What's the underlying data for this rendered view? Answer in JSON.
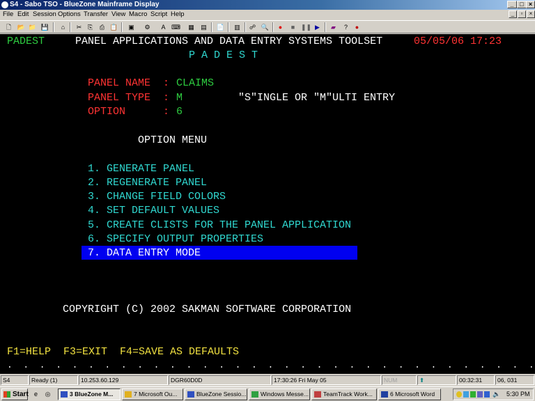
{
  "window": {
    "title": "S4 - Sabo TSO - BlueZone Mainframe Display"
  },
  "menu": [
    "File",
    "Edit",
    "Session",
    "Options",
    "Transfer",
    "View",
    "Macro",
    "Script",
    "Help"
  ],
  "terminal": {
    "app_id": "PADEST",
    "header_title": "PANEL APPLICATIONS AND DATA ENTRY SYSTEMS TOOLSET",
    "datetime": "05/05/06 17:23",
    "subtitle": "P A D E S T",
    "fields": [
      {
        "label": "PANEL NAME  :",
        "value": "CLAIMS",
        "hint": ""
      },
      {
        "label": "PANEL TYPE  :",
        "value": "M",
        "hint": "\"S\"INGLE OR \"M\"ULTI ENTRY"
      },
      {
        "label": "OPTION      :",
        "value": "6",
        "hint": ""
      }
    ],
    "menu_title": "OPTION MENU",
    "options": [
      "1. GENERATE PANEL",
      "2. REGENERATE PANEL",
      "3. CHANGE FIELD COLORS",
      "4. SET DEFAULT VALUES",
      "5. CREATE CLISTS FOR THE PANEL APPLICATION",
      "6. SPECIFY OUTPUT PROPERTIES",
      "7. DATA ENTRY MODE"
    ],
    "copyright": "COPYRIGHT (C) 2002 SAKMAN SOFTWARE CORPORATION",
    "pfkeys": "F1=HELP  F3=EXIT  F4=SAVE AS DEFAULTS",
    "dots": ".  .  .  .  .  .  .  .  .  .  .  .  .  .  .  .  .  .  .  .  .  .  .  .  .  .  .  .  .  .  .  .  .  ."
  },
  "status": {
    "session": "S4",
    "state": "Ready (1)",
    "ip": "10.253.60.129",
    "lu": "DGR60D0D",
    "datetime": "17:30:26  Fri May 05",
    "num": "NUM",
    "elapsed": "00:32:31",
    "cursor": "06, 031"
  },
  "taskbar": {
    "start": "Start",
    "tasks": [
      "3 BlueZone M...",
      "7 Microsoft Ou...",
      "BlueZone Sessio...",
      "Windows Messe...",
      "TeamTrack Work...",
      "6 Microsoft Word"
    ],
    "clock": "5:30 PM"
  },
  "colors": {
    "terminal_bg": "#000000",
    "field_label": "#ff3333",
    "field_value": "#2ecc40",
    "menu_text": "#30d8d0",
    "highlight": "#0000f0"
  }
}
